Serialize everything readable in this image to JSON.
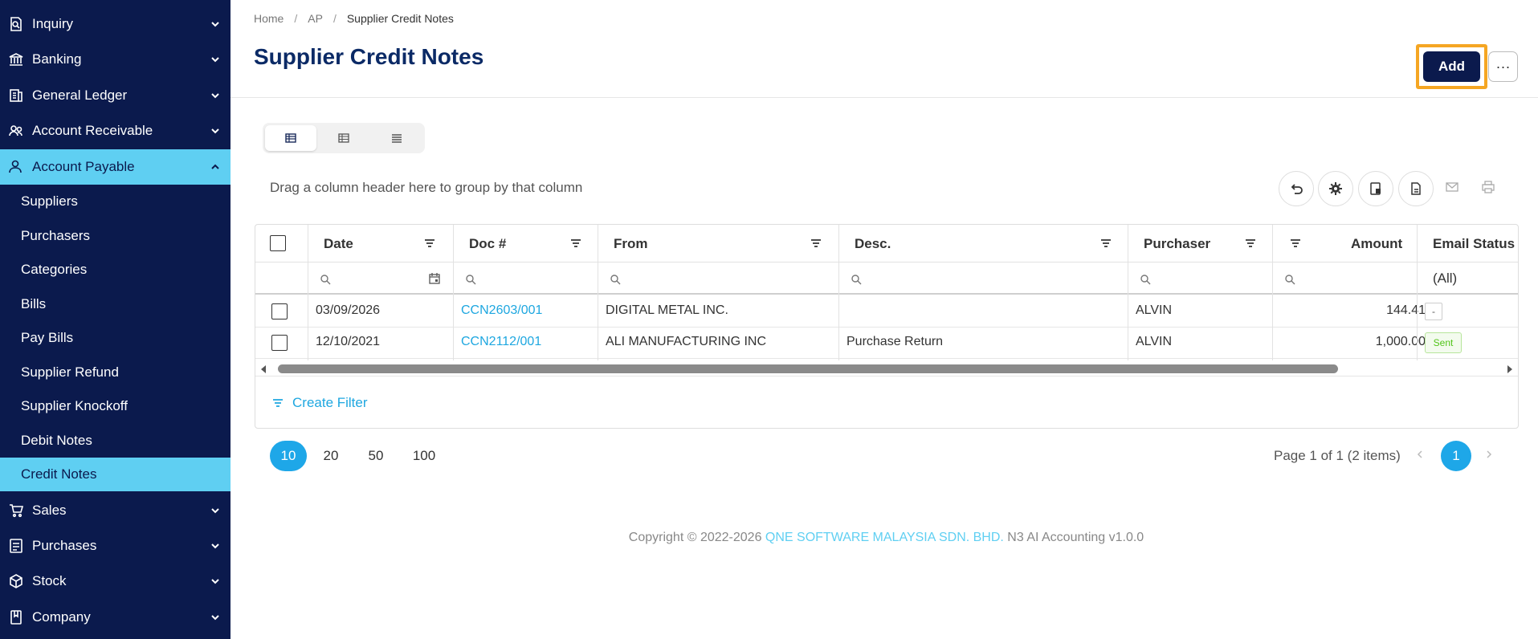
{
  "sidebar": {
    "groups": [
      {
        "label": "Inquiry",
        "icon": "inquiry-icon"
      },
      {
        "label": "Banking",
        "icon": "bank-icon"
      },
      {
        "label": "General Ledger",
        "icon": "ledger-icon"
      },
      {
        "label": "Account Receivable",
        "icon": "receivable-icon"
      },
      {
        "label": "Account Payable",
        "icon": "user-icon",
        "active": true
      },
      {
        "label": "Sales",
        "icon": "cart-icon"
      },
      {
        "label": "Purchases",
        "icon": "purchases-icon"
      },
      {
        "label": "Stock",
        "icon": "box-icon"
      },
      {
        "label": "Company",
        "icon": "book-icon"
      }
    ],
    "sub_items": [
      {
        "label": "Suppliers"
      },
      {
        "label": "Purchasers"
      },
      {
        "label": "Categories"
      },
      {
        "label": "Bills"
      },
      {
        "label": "Pay Bills"
      },
      {
        "label": "Supplier Refund"
      },
      {
        "label": "Supplier Knockoff"
      },
      {
        "label": "Debit Notes"
      },
      {
        "label": "Credit Notes",
        "active": true
      }
    ]
  },
  "breadcrumb": {
    "home": "Home",
    "ap": "AP",
    "current": "Supplier Credit Notes",
    "sep": "/"
  },
  "page_title": "Supplier Credit Notes",
  "header": {
    "add_label": "Add",
    "more_label": "···"
  },
  "grid": {
    "group_hint": "Drag a column header here to group by that column",
    "columns": [
      "Date",
      "Doc #",
      "From",
      "Desc.",
      "Purchaser",
      "Amount",
      "Email Status"
    ],
    "email_filter_value": "(All)",
    "rows": [
      {
        "date": "03/09/2026",
        "doc": "CCN2603/001",
        "from": "DIGITAL METAL INC.",
        "desc": "",
        "purchaser": "ALVIN",
        "amount": "144.41",
        "email_status": "-"
      },
      {
        "date": "12/10/2021",
        "doc": "CCN2112/001",
        "from": "ALI MANUFACTURING INC",
        "desc": "Purchase Return",
        "purchaser": "ALVIN",
        "amount": "1,000.00",
        "email_status": "Sent"
      }
    ],
    "create_filter": "Create Filter"
  },
  "pager": {
    "sizes": [
      "10",
      "20",
      "50",
      "100"
    ],
    "selected_size": "10",
    "info": "Page 1 of 1 (2 items)",
    "current_page": "1"
  },
  "footer": {
    "prefix": "Copyright © 2022-2026 ",
    "company": "QNE SOFTWARE MALAYSIA SDN. BHD.",
    "suffix": " N3 AI Accounting v1.0.0"
  },
  "colors": {
    "sidebar_bg": "#0b1a4d",
    "active_bg": "#5fcff2",
    "accent": "#1ea7e8",
    "highlight": "#f5a623"
  }
}
